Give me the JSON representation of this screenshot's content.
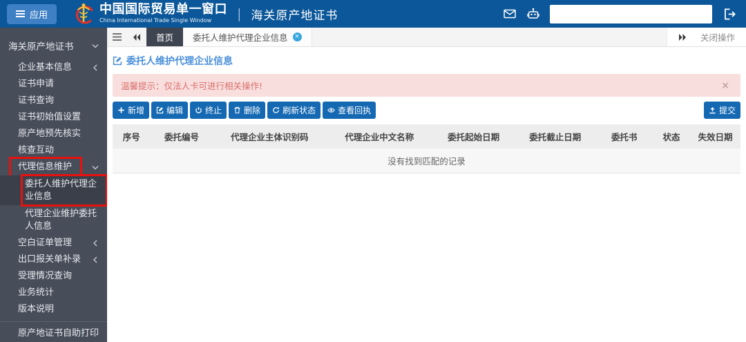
{
  "colors": {
    "header_bg": "#0b5799",
    "apps_button_bg": "#3f80c4",
    "sidebar_bg": "#474d59",
    "sidebar_active_bg": "#3a3f4a",
    "highlight_red": "#e8110f",
    "tab_active_bg": "#3e4551",
    "title_blue": "#4a90da",
    "alert_bg": "#f8dedd",
    "alert_text": "#d9706c",
    "button_blue": "#1569b3",
    "tab_close_teal": "#35a7dc"
  },
  "header": {
    "apps_button_label": "应用",
    "brand_title": "中国国际贸易单一窗口",
    "brand_subtitle": "China International Trade Single Window",
    "divider": "|",
    "module_title": "海关原产地证书",
    "icons": [
      "mail-icon",
      "robot-icon",
      "logout-icon"
    ]
  },
  "sidebar": {
    "root_label": "海关原产地证书",
    "items": [
      {
        "label": "企业基本信息",
        "chevron": "left"
      },
      {
        "label": "证书申请"
      },
      {
        "label": "证书查询"
      },
      {
        "label": "证书初始值设置"
      },
      {
        "label": "原产地预先核实"
      },
      {
        "label": "核查互动"
      },
      {
        "label": "代理信息维护",
        "chevron": "down",
        "highlighted": true
      },
      {
        "label": "委托人维护代理企业信息",
        "sub": true,
        "active": true,
        "highlighted": true
      },
      {
        "label": "代理企业维护委托人信息",
        "sub": true
      },
      {
        "label": "空白证单管理",
        "chevron": "left"
      },
      {
        "label": "出口报关单补录",
        "chevron": "left"
      },
      {
        "label": "受理情况查询"
      },
      {
        "label": "业务统计"
      },
      {
        "label": "版本说明"
      },
      {
        "label": "原产地证书自助打印",
        "section": "bottom"
      }
    ]
  },
  "tabs": {
    "home": "首页",
    "active_tab": "委托人维护代理企业信息",
    "close_menu": "关闭操作"
  },
  "page": {
    "title": "委托人维护代理企业信息"
  },
  "alert": {
    "message": "温馨提示：仅法人卡可进行相关操作!",
    "close_icon": "×"
  },
  "toolbar": {
    "buttons": [
      {
        "icon": "plus-icon",
        "label": "新增"
      },
      {
        "icon": "edit-icon",
        "label": "编辑"
      },
      {
        "icon": "power-icon",
        "label": "终止"
      },
      {
        "icon": "trash-icon",
        "label": "删除"
      },
      {
        "icon": "refresh-icon",
        "label": "刷新状态"
      },
      {
        "icon": "eye-icon",
        "label": "查看回执"
      }
    ],
    "submit_label": "提交"
  },
  "table": {
    "columns": [
      "序号",
      "委托编号",
      "代理企业主体识别码",
      "代理企业中文名称",
      "委托起始日期",
      "委托截止日期",
      "委托书",
      "状态",
      "失效日期"
    ],
    "empty_message": "没有找到匹配的记录"
  }
}
